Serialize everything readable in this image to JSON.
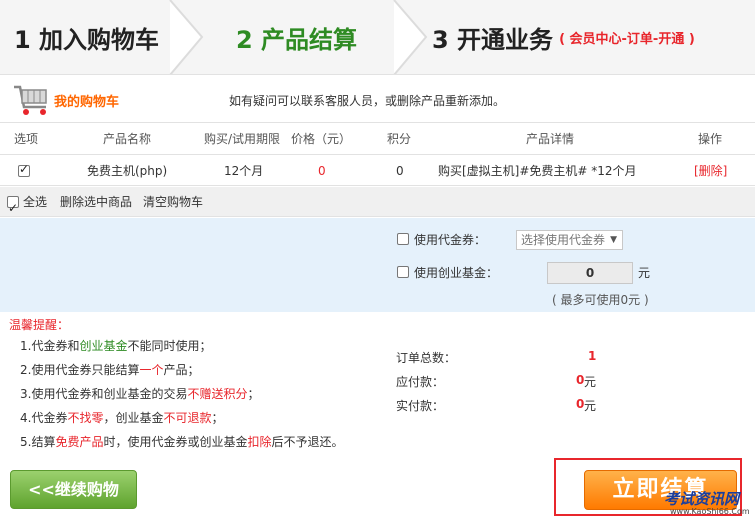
{
  "steps": {
    "step1": "1 加入购物车",
    "step2": "2 产品结算",
    "step3": "3 开通业务",
    "step3_note": "( 会员中心-订单-开通 )"
  },
  "cart": {
    "title": "我的购物车",
    "tip": "如有疑问可以联系客服人员，或删除产品重新添加。"
  },
  "table": {
    "headers": [
      "选项",
      "产品名称",
      "购买/试用期限",
      "价格（元）",
      "积分",
      "产品详情",
      "操作"
    ],
    "rows": [
      {
        "name": "免费主机(php)",
        "period": "12个月",
        "price": "0",
        "points": "0",
        "detail": "购买[虚拟主机]#免费主机# *12个月",
        "action": "[删除]"
      }
    ]
  },
  "selectbar": {
    "select_all": "全选",
    "delete_selected": "删除选中商品",
    "clear_cart": "清空购物车"
  },
  "coupon": {
    "use_coupon_label": "使用代金券：",
    "coupon_select": "选择使用代金券",
    "use_fund_label": "使用创业基金：",
    "fund_value": "0",
    "fund_unit": "元",
    "fund_max": "( 最多可使用0元 )"
  },
  "tips": {
    "title": "温馨提醒：",
    "t1a": "1.代金券和",
    "t1b": "创业基金",
    "t1c": "不能同时使用；",
    "t2a": "2.使用代金券只能结算",
    "t2b": "一个",
    "t2c": "产品；",
    "t3a": "3.使用代金券和创业基金的交易",
    "t3b": "不赠送积分",
    "t3c": "；",
    "t4a": "4.代金券",
    "t4b": "不找零",
    "t4c": "，创业基金",
    "t4d": "不可退款",
    "t4e": "；",
    "t5a": "5.结算",
    "t5b": "免费产品",
    "t5c": "时，使用代金券或创业基金",
    "t5d": "扣除",
    "t5e": "后不予退还。"
  },
  "totals": {
    "count_label": "订单总数：",
    "count_value": "1",
    "payable_label": "应付款：",
    "payable_value": "0",
    "paid_label": "实付款：",
    "paid_value": "0",
    "unit": "元"
  },
  "buttons": {
    "continue": "<<继续购物",
    "pay": "立即结算"
  },
  "watermark": {
    "text": "考试资讯网",
    "sub": "www.KaoShi66.Com"
  },
  "colors": {
    "accent_green": "#2e8b23",
    "accent_red": "#e8262c",
    "accent_orange": "#ff7a00",
    "panel_blue": "#e5f1fb"
  }
}
